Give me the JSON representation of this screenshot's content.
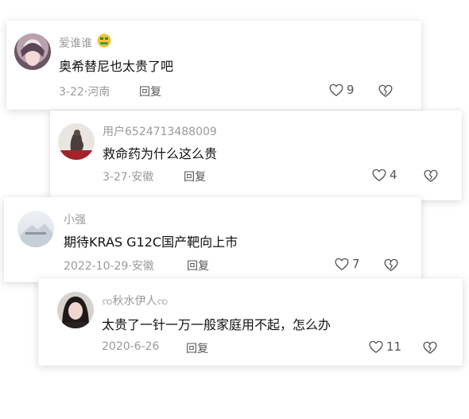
{
  "comments": [
    {
      "username": "爱谁谁",
      "badge_icon": "money-mouth-emoji-icon",
      "text": "奥希替尼也太贵了吧",
      "date_location": "3-22·河南",
      "reply_label": "回复",
      "likes": "9",
      "avatar_icon": "avatar-photo"
    },
    {
      "username": "用户6524713488009",
      "text": "救命药为什么这么贵",
      "date_location": "3-27·安徽",
      "reply_label": "回复",
      "likes": "4",
      "avatar_icon": "avatar-photo"
    },
    {
      "username": "小强",
      "text": "期待KRAS G12C国产靶向上市",
      "date_location": "2022-10-29·安徽",
      "reply_label": "回复",
      "likes": "7",
      "avatar_icon": "avatar-photo"
    },
    {
      "username": "ꩡ秋水伊人ꩡ",
      "text": "太贵了一针一万一般家庭用不起，怎么办",
      "date_location": "2020-6-26",
      "reply_label": "回复",
      "likes": "11",
      "avatar_icon": "avatar-photo"
    }
  ],
  "colors": {
    "meta_gray": "#9a9a9a",
    "text_black": "#111111",
    "icon_gray": "#555555"
  }
}
